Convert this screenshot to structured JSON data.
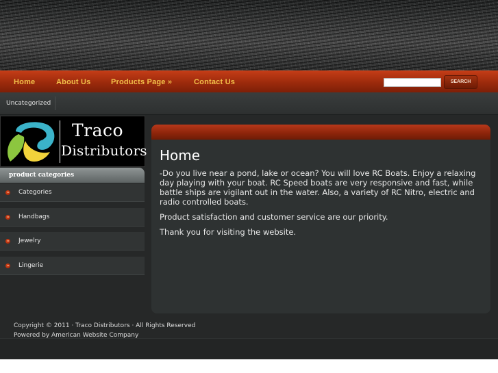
{
  "nav": {
    "items": [
      {
        "label": "Home"
      },
      {
        "label": "About Us"
      },
      {
        "label": "Products Page »"
      },
      {
        "label": "Contact Us"
      }
    ],
    "search_value": "",
    "search_button": "SEARCH"
  },
  "subnav": {
    "items": [
      {
        "label": "Uncategorized"
      }
    ]
  },
  "logo": {
    "title": "Traco",
    "subtitle": "Distributors",
    "colors": {
      "blue": "#3bb3c9",
      "green": "#8cc63f",
      "yellow": "#f2d33b"
    }
  },
  "sidebar": {
    "heading": "product categories",
    "items": [
      {
        "label": "Categories"
      },
      {
        "label": "Handbags"
      },
      {
        "label": "Jewelry"
      },
      {
        "label": "Lingerie"
      }
    ]
  },
  "content": {
    "title": "Home",
    "paragraphs": [
      "-Do you live near a pond, lake or ocean?  You will love RC Boats.  Enjoy a relaxing day playing with your boat.  RC Speed boats are very responsive and fast, while battle ships are vigilant out in the water.  Also, a variety of RC Nitro, electric and radio controlled boats.",
      "Product satisfaction and customer service are our priority.",
      "Thank you for visiting the website."
    ]
  },
  "footer": {
    "copyright": "Copyright © 2011 · Traco Distributors · All Rights Reserved",
    "powered": "Powered by American Website Company"
  },
  "colors": {
    "accent": "#a8300f",
    "nav_text": "#f2c04a",
    "background": "#262828"
  }
}
